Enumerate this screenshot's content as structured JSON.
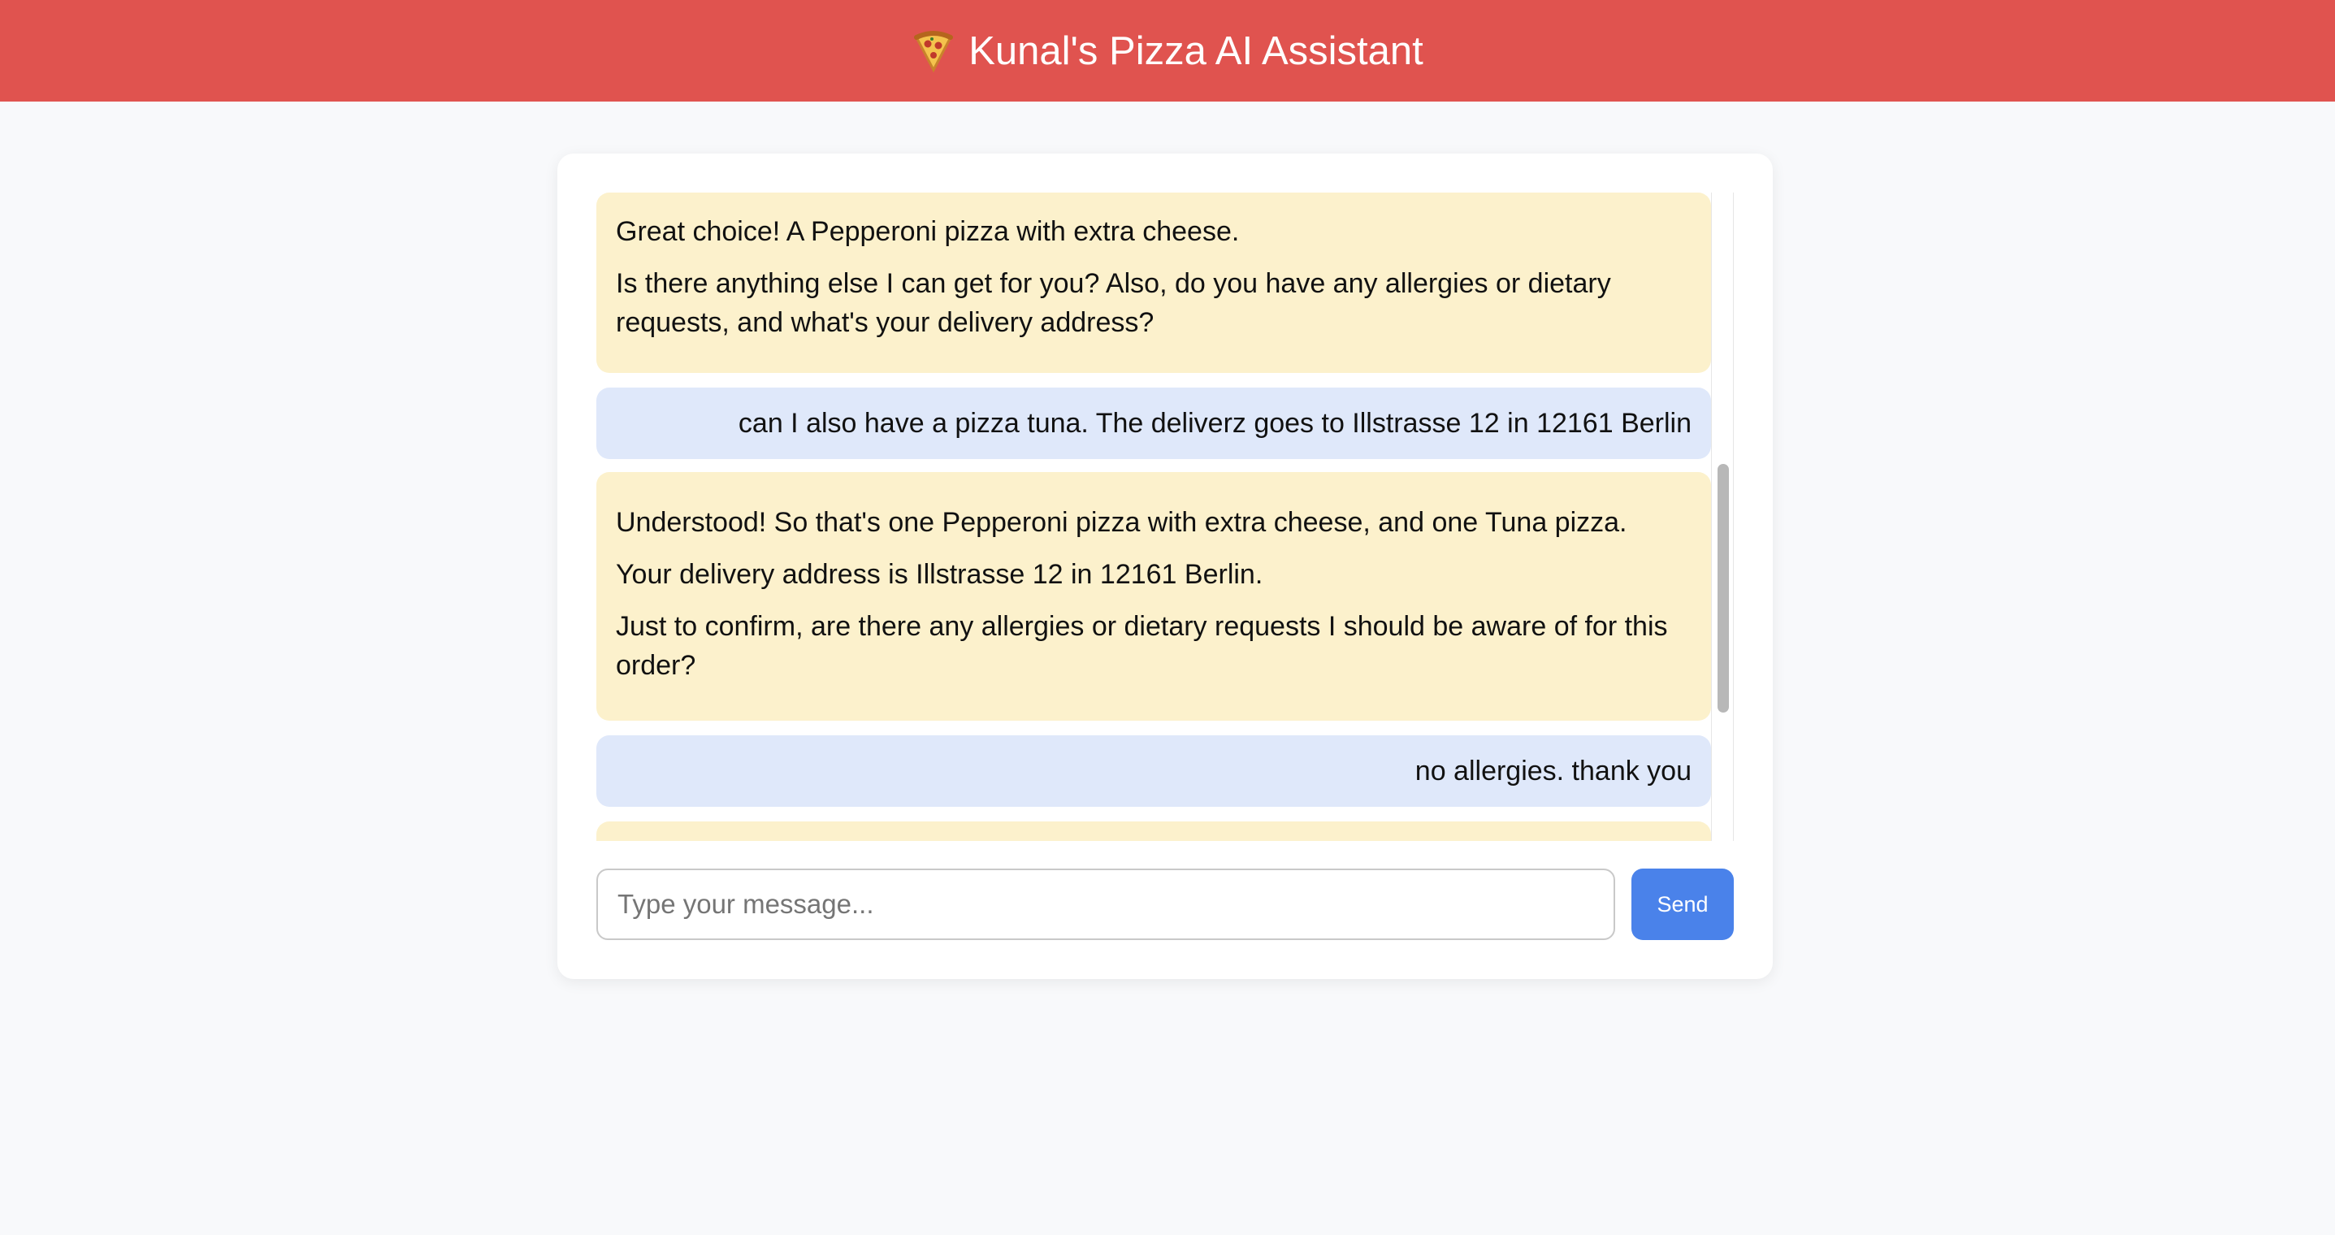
{
  "header": {
    "logo_icon": "pizza-slice-icon",
    "title": "Kunal's Pizza AI Assistant"
  },
  "messages": [
    {
      "role": "assistant",
      "lines": [
        "Great choice! A Pepperoni pizza with extra cheese.",
        "Is there anything else I can get for you? Also, do you have any allergies or dietary requests, and what's your delivery address?"
      ]
    },
    {
      "role": "user",
      "text": "can I also have a pizza tuna. The deliverz goes to Illstrasse 12 in 12161 Berlin"
    },
    {
      "role": "assistant",
      "lines": [
        "Understood! So that's one Pepperoni pizza with extra cheese, and one Tuna pizza.",
        "Your delivery address is Illstrasse 12 in 12161 Berlin.",
        "Just to confirm, are there any allergies or dietary requests I should be aware of for this order?"
      ]
    },
    {
      "role": "user",
      "text": "no allergies. thank you"
    },
    {
      "role": "assistant",
      "lines": []
    }
  ],
  "composer": {
    "placeholder": "Type your message...",
    "send_label": "Send"
  },
  "colors": {
    "header_bg": "#e0534f",
    "assistant_bubble": "#fcf1cc",
    "user_bubble": "#dfe8fa",
    "send_button": "#4a82ea"
  }
}
